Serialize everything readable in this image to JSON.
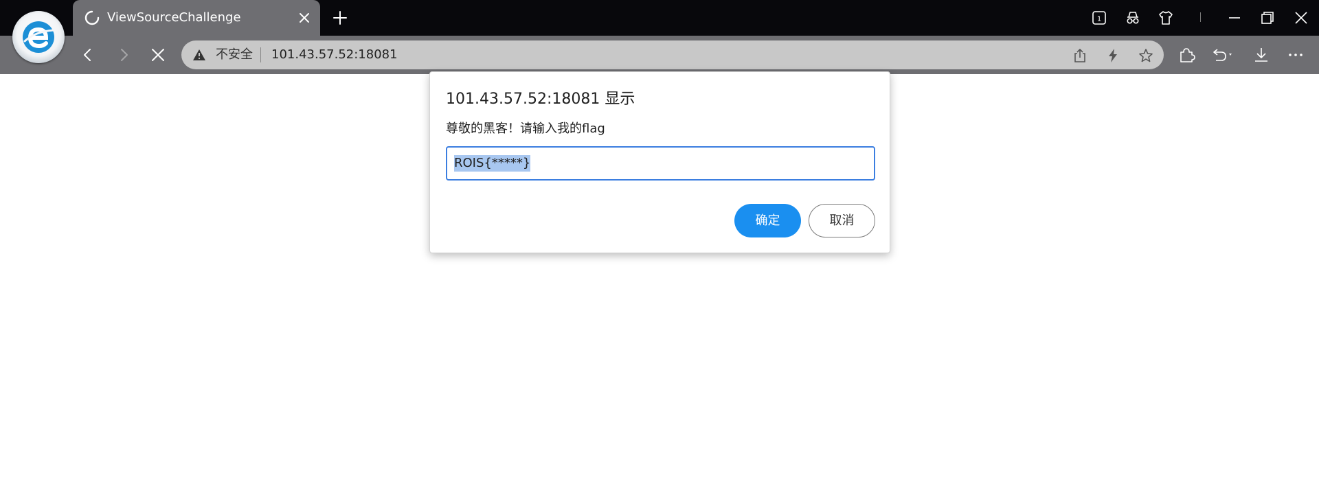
{
  "browser": {
    "logo_icon": "edge-e-logo-icon",
    "tab": {
      "title": "ViewSourceChallenge",
      "status_icon": "loading-spinner-icon",
      "close_icon": "close-icon"
    },
    "new_tab_icon": "plus-icon",
    "title_bar_icons": [
      "tab-count-icon",
      "incognito-icon",
      "shirt-icon",
      "divider",
      "minimize-icon",
      "restore-icon",
      "close-icon"
    ],
    "tab_count": "1"
  },
  "toolbar": {
    "back_icon": "chevron-left-icon",
    "forward_icon": "chevron-right-icon",
    "stop_icon": "close-x-icon",
    "address": {
      "warning_icon": "warning-triangle-icon",
      "security_label": "不安全",
      "url": "101.43.57.52:18081",
      "share_icon": "share-icon",
      "lightning_icon": "lightning-icon",
      "favorite_icon": "star-icon"
    },
    "right_icons": [
      "extensions-icon",
      "undo-icon",
      "download-icon",
      "more-icon"
    ]
  },
  "dialog": {
    "title": "101.43.57.52:18081 显示",
    "message": "尊敬的黑客！请输入我的flag",
    "input_value": "ROIS{*****}",
    "ok_label": "确定",
    "cancel_label": "取消",
    "colors": {
      "primary": "#1a8ff0",
      "focus_border": "#3b7ee0",
      "selection": "#a8c7f0"
    }
  }
}
